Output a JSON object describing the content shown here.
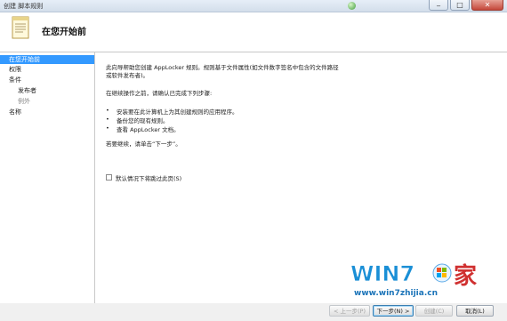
{
  "window": {
    "title": "创建 脚本规则",
    "minimize_glyph": "_",
    "maximize_glyph": "□",
    "close_glyph": "✕"
  },
  "header": {
    "title": "在您开始前",
    "icon": "document-icon"
  },
  "nav": {
    "items": [
      {
        "label": "在您开始前",
        "selected": true
      },
      {
        "label": "权限"
      },
      {
        "label": "条件"
      },
      {
        "label": "发布者"
      },
      {
        "label": "例外"
      },
      {
        "label": "名称"
      }
    ]
  },
  "content": {
    "intro_line1": "此向导帮助您创建 AppLocker 规则。规则基于文件属性(如文件数字签名中包含的文件路径",
    "intro_line2": "或软件发布者)。",
    "before_continue": "在继续操作之前，请确认已完成下列步骤:",
    "bullets": [
      "安装要在此计算机上为其创建规则的应用程序。",
      "备份您的现有规则。",
      "查看 AppLocker 文档。"
    ],
    "continue_hint": "若要继续，请单击“下一步”。",
    "skip_checkbox_label": "默认情况下将跳过此页(S)",
    "skip_checked": false
  },
  "footer": {
    "back_label": "< 上一步(P)",
    "next_label": "下一步(N) >",
    "create_label": "创建(C)",
    "cancel_label": "取消(L)"
  },
  "watermark": {
    "brand": "WIN7",
    "brand_suffix": "家",
    "url": "www.win7zhijia.cn"
  }
}
